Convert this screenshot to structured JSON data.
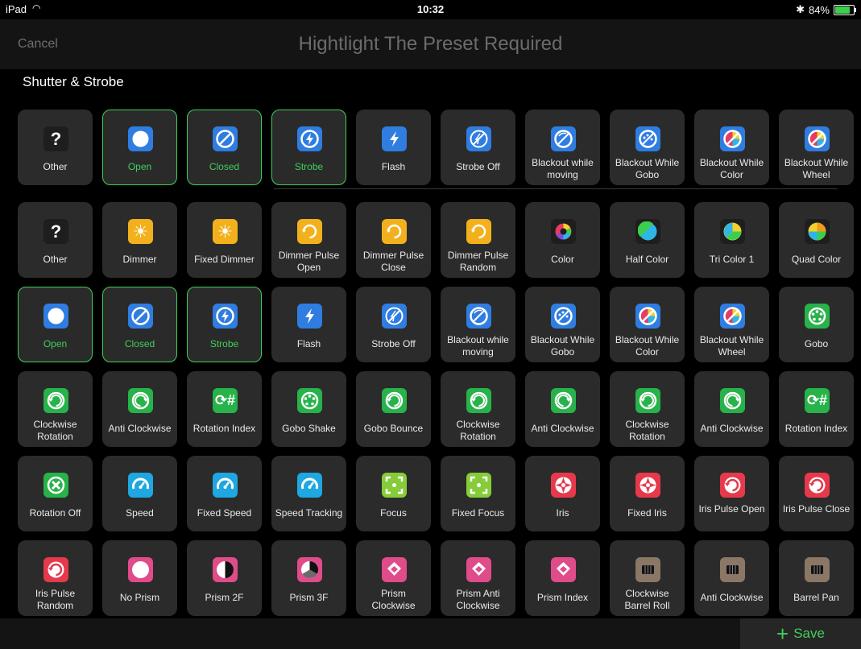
{
  "status": {
    "carrier": "iPad",
    "time": "10:32",
    "battery": "84%"
  },
  "nav": {
    "cancel": "Cancel",
    "title": "Hightlight The Preset Required"
  },
  "section": "Shutter & Strobe",
  "save": "Save",
  "colors": {
    "accent": "#3fd05a",
    "shutterBlue": "#2f7de0",
    "dimmerOrange": "#f2b11c",
    "goboGreen": "#27b24a",
    "speedCyan": "#1ea7e0",
    "irisRed": "#e6394b",
    "prismPink": "#e04b8a",
    "barrelBrown": "#8a7765"
  },
  "rows": [
    [
      {
        "label": "Other",
        "icon": "question-icon",
        "selected": false
      },
      {
        "label": "Open",
        "icon": "open-shutter-icon",
        "selected": true
      },
      {
        "label": "Closed",
        "icon": "closed-shutter-icon",
        "selected": true
      },
      {
        "label": "Strobe",
        "icon": "strobe-icon",
        "selected": true
      },
      {
        "label": "Flash",
        "icon": "flash-icon",
        "selected": false
      },
      {
        "label": "Strobe Off",
        "icon": "strobe-off-icon",
        "selected": false
      },
      {
        "label": "Blackout while moving",
        "icon": "blackout-moving-icon",
        "selected": false
      },
      {
        "label": "Blackout While Gobo",
        "icon": "blackout-gobo-icon",
        "selected": false
      },
      {
        "label": "Blackout While Color",
        "icon": "blackout-color-icon",
        "selected": false
      },
      {
        "label": "Blackout While Wheel",
        "icon": "blackout-wheel-icon",
        "selected": false
      }
    ],
    [
      {
        "label": "Other",
        "icon": "question-icon",
        "selected": false
      },
      {
        "label": "Dimmer",
        "icon": "sun-icon",
        "selected": false
      },
      {
        "label": "Fixed Dimmer",
        "icon": "sun-icon",
        "selected": false
      },
      {
        "label": "Dimmer Pulse Open",
        "icon": "dimmer-pulse-open-icon",
        "selected": false
      },
      {
        "label": "Dimmer Pulse Close",
        "icon": "dimmer-pulse-close-icon",
        "selected": false
      },
      {
        "label": "Dimmer Pulse Random",
        "icon": "dimmer-pulse-random-icon",
        "selected": false
      },
      {
        "label": "Color",
        "icon": "color-wheel-icon",
        "selected": false
      },
      {
        "label": "Half Color",
        "icon": "half-color-icon",
        "selected": false
      },
      {
        "label": "Tri Color 1",
        "icon": "tri-color-icon",
        "selected": false
      },
      {
        "label": "Quad Color",
        "icon": "quad-color-icon",
        "selected": false
      }
    ],
    [
      {
        "label": "Open",
        "icon": "open-shutter-icon",
        "selected": true
      },
      {
        "label": "Closed",
        "icon": "closed-shutter-icon",
        "selected": true
      },
      {
        "label": "Strobe",
        "icon": "strobe-icon",
        "selected": true
      },
      {
        "label": "Flash",
        "icon": "flash-icon",
        "selected": false
      },
      {
        "label": "Strobe Off",
        "icon": "strobe-off-icon",
        "selected": false
      },
      {
        "label": "Blackout while moving",
        "icon": "blackout-moving-icon",
        "selected": false
      },
      {
        "label": "Blackout While Gobo",
        "icon": "blackout-gobo-icon",
        "selected": false
      },
      {
        "label": "Blackout While Color",
        "icon": "blackout-color-icon",
        "selected": false
      },
      {
        "label": "Blackout While Wheel",
        "icon": "blackout-wheel-icon",
        "selected": false
      },
      {
        "label": "Gobo",
        "icon": "gobo-icon",
        "selected": false
      }
    ],
    [
      {
        "label": "Clockwise Rotation",
        "icon": "clockwise-rotation-icon",
        "selected": false
      },
      {
        "label": "Anti Clockwise",
        "icon": "anticlockwise-rotation-icon",
        "selected": false
      },
      {
        "label": "Rotation Index",
        "icon": "rotation-index-icon",
        "selected": false
      },
      {
        "label": "Gobo Shake",
        "icon": "gobo-shake-icon",
        "selected": false
      },
      {
        "label": "Gobo Bounce",
        "icon": "gobo-bounce-icon",
        "selected": false
      },
      {
        "label": "Clockwise Rotation",
        "icon": "clockwise-rotation-icon",
        "selected": false
      },
      {
        "label": "Anti Clockwise",
        "icon": "anticlockwise-rotation-icon",
        "selected": false
      },
      {
        "label": "Clockwise Rotation",
        "icon": "clockwise-rotation-icon",
        "selected": false
      },
      {
        "label": "Anti Clockwise",
        "icon": "anticlockwise-rotation-icon",
        "selected": false
      },
      {
        "label": "Rotation Index",
        "icon": "rotation-index-icon",
        "selected": false
      }
    ],
    [
      {
        "label": "Rotation Off",
        "icon": "rotation-off-icon",
        "selected": false
      },
      {
        "label": "Speed",
        "icon": "speedometer-icon",
        "selected": false
      },
      {
        "label": "Fixed Speed",
        "icon": "speedometer-icon",
        "selected": false
      },
      {
        "label": "Speed Tracking",
        "icon": "speed-tracking-icon",
        "selected": false
      },
      {
        "label": "Focus",
        "icon": "focus-icon",
        "selected": false
      },
      {
        "label": "Fixed Focus",
        "icon": "focus-icon",
        "selected": false
      },
      {
        "label": "Iris",
        "icon": "iris-icon",
        "selected": false
      },
      {
        "label": "Fixed Iris",
        "icon": "iris-icon",
        "selected": false
      },
      {
        "label": "Iris Pulse Open",
        "icon": "iris-pulse-open-icon",
        "selected": false
      },
      {
        "label": "Iris Pulse Close",
        "icon": "iris-pulse-close-icon",
        "selected": false
      }
    ],
    [
      {
        "label": "Iris Pulse Random",
        "icon": "iris-pulse-random-icon",
        "selected": false
      },
      {
        "label": "No Prism",
        "icon": "no-prism-icon",
        "selected": false
      },
      {
        "label": "Prism 2F",
        "icon": "prism-2f-icon",
        "selected": false
      },
      {
        "label": "Prism 3F",
        "icon": "prism-3f-icon",
        "selected": false
      },
      {
        "label": "Prism Clockwise",
        "icon": "prism-clockwise-icon",
        "selected": false
      },
      {
        "label": "Prism Anti Clockwise",
        "icon": "prism-anticlockwise-icon",
        "selected": false
      },
      {
        "label": "Prism Index",
        "icon": "prism-index-icon",
        "selected": false
      },
      {
        "label": "Clockwise Barrel Roll",
        "icon": "barrel-roll-clockwise-icon",
        "selected": false
      },
      {
        "label": "Anti Clockwise",
        "icon": "barrel-roll-anticlockwise-icon",
        "selected": false
      },
      {
        "label": "Barrel Pan",
        "icon": "barrel-pan-icon",
        "selected": false
      }
    ]
  ]
}
